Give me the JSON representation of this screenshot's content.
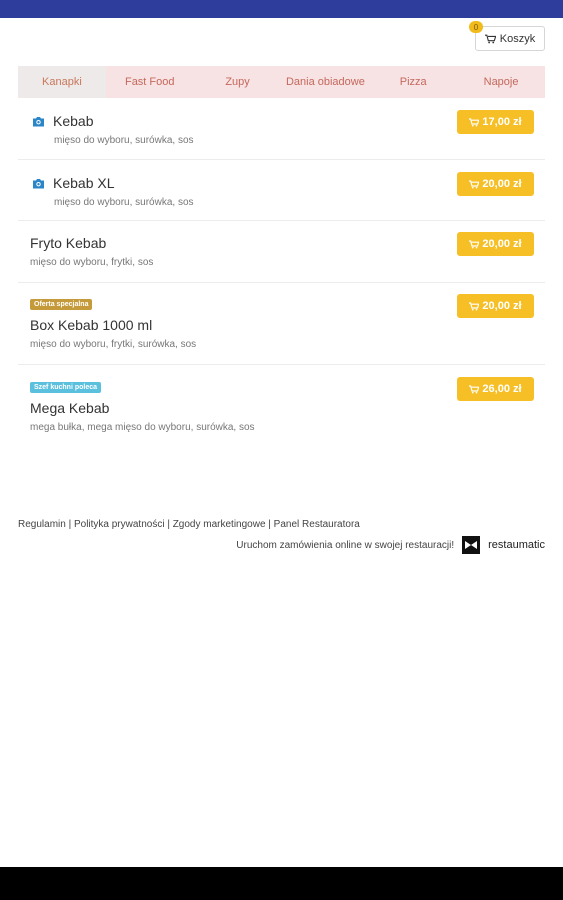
{
  "cart": {
    "label": "Koszyk",
    "count": "0"
  },
  "tabs": [
    {
      "label": "Kanapki"
    },
    {
      "label": "Fast Food"
    },
    {
      "label": "Zupy"
    },
    {
      "label": "Dania obiadowe"
    },
    {
      "label": "Pizza"
    },
    {
      "label": "Napoje"
    }
  ],
  "items": [
    {
      "name": "Kebab",
      "desc": "mięso do wyboru, surówka, sos",
      "price": "17,00 zł"
    },
    {
      "name": "Kebab XL",
      "desc": "mięso do wyboru, surówka, sos",
      "price": "20,00 zł"
    },
    {
      "name": "Fryto Kebab",
      "desc": "mięso do wyboru, frytki, sos",
      "price": "20,00 zł"
    },
    {
      "name": "Box Kebab 1000 ml",
      "desc": "mięso do wyboru, frytki, surówka, sos",
      "price": "20,00 zł",
      "badge": "Oferta specjalna"
    },
    {
      "name": "Mega Kebab",
      "desc": "mega bułka, mega mięso do wyboru, surówka, sos",
      "price": "26,00 zł",
      "badge": "Szef kuchni poleca"
    }
  ],
  "footer": {
    "links": "Regulamin | Polityka prywatności | Zgody marketingowe | Panel Restauratora",
    "cta": "Uruchom zamówienia online w swojej restauracji!",
    "brand": "restaumatic"
  },
  "colors": {
    "top_bar": "#2e3c9c",
    "price_button": "#f6bf26",
    "special_offer_badge": "#c59a3a",
    "chef_badge": "#5bc0de",
    "camera_icon": "#2a85c9"
  }
}
